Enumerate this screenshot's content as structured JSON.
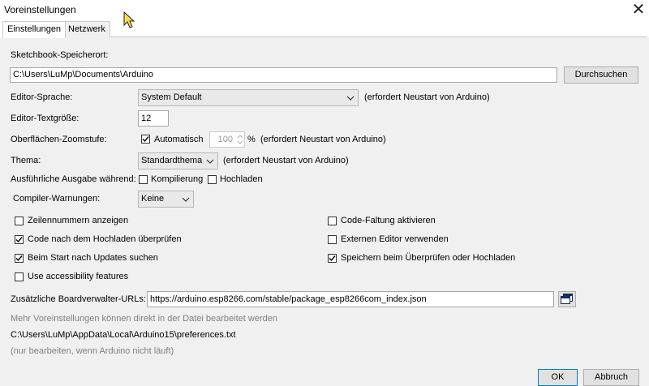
{
  "window": {
    "title": "Voreinstellungen"
  },
  "tabs": [
    {
      "label": "Einstellungen"
    },
    {
      "label": "Netzwerk"
    }
  ],
  "sketchbook": {
    "label": "Sketchbook-Speicherort:",
    "path": "C:\\Users\\LuMp\\Documents\\Arduino",
    "browse_label": "Durchsuchen"
  },
  "language": {
    "label": "Editor-Sprache:",
    "value": "System Default",
    "note": "(erfordert Neustart von Arduino)"
  },
  "textsize": {
    "label": "Editor-Textgröße:",
    "value": "12"
  },
  "zoom": {
    "label": "Oberflächen-Zoomstufe:",
    "auto_label": "Automatisch",
    "value": "100",
    "unit": "%",
    "note": "(erfordert Neustart von Arduino)"
  },
  "theme": {
    "label": "Thema:",
    "value": "Standardthema",
    "note": "(erfordert Neustart von Arduino)"
  },
  "verbose": {
    "label": "Ausführliche Ausgabe während:",
    "compile_label": "Kompilierung",
    "upload_label": "Hochladen"
  },
  "warnings": {
    "label": "Compiler-Warnungen:",
    "value": "Keine"
  },
  "options": {
    "line_numbers": "Zeilennummern anzeigen",
    "verify_upload": "Code nach dem Hochladen überprüfen",
    "check_updates": "Beim Start nach Updates suchen",
    "accessibility": "Use accessibility features",
    "code_folding": "Code-Faltung aktivieren",
    "external_editor": "Externen Editor verwenden",
    "save_on_verify": "Speichern beim Überprüfen oder Hochladen"
  },
  "boards": {
    "label": "Zusätzliche Boardverwalter-URLs:",
    "value": "https://arduino.esp8266.com/stable/package_esp8266com_index.json"
  },
  "info": {
    "more": "Mehr Voreinstellungen können direkt in der Datei bearbeitet werden",
    "path": "C:\\Users\\LuMp\\AppData\\Local\\Arduino15\\preferences.txt",
    "hint": "(nur bearbeiten, wenn Arduino nicht läuft)"
  },
  "buttons": {
    "ok": "OK",
    "cancel": "Abbruch"
  }
}
